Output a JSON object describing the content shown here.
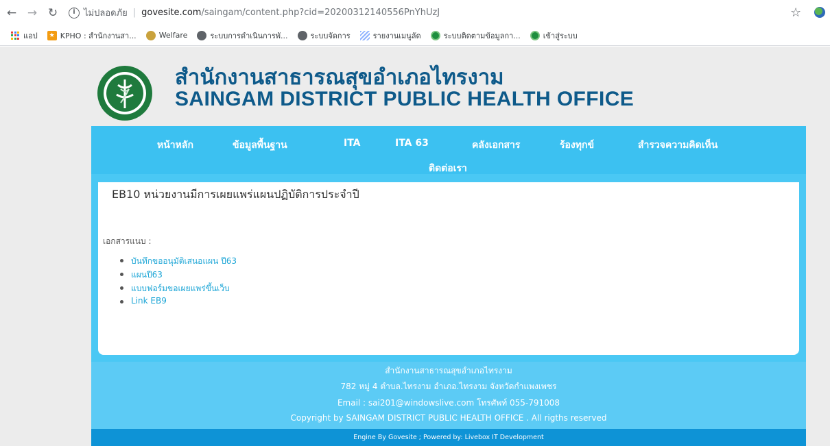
{
  "browser": {
    "security_label": "ไม่ปลอดภัย",
    "url_host": "govesite.com",
    "url_path": "/saingam/content.php?cid=20200312140556PnYhUzJ"
  },
  "bookmarks": [
    {
      "label": "แอป",
      "icon": "apps-grid-icon"
    },
    {
      "label": "KPHO : สำนักงานสา...",
      "icon": "kpho-icon"
    },
    {
      "label": "Welfare",
      "icon": "seal-icon"
    },
    {
      "label": "ระบบการดำเนินการพั...",
      "icon": "globe-icon"
    },
    {
      "label": "ระบบจัดการ",
      "icon": "globe-icon"
    },
    {
      "label": "รายงานเมนูลัด",
      "icon": "report-icon"
    },
    {
      "label": "ระบบติดตามข้อมูลกา...",
      "icon": "green-circle-icon"
    },
    {
      "label": "เข้าสู่ระบบ",
      "icon": "green-circle-icon"
    }
  ],
  "site": {
    "title_th": "สำนักงานสาธารณสุขอำเภอไทรงาม",
    "title_en": "SAINGAM DISTRICT PUBLIC HEALTH OFFICE"
  },
  "nav": {
    "items": [
      "หน้าหลัก",
      "ข้อมูลพื้นฐาน",
      "ITA",
      "ITA 63",
      "คลังเอกสาร",
      "ร้องทุกข์",
      "สำรวจความคิดเห็น",
      "ติดต่อเรา"
    ]
  },
  "content": {
    "title": "EB10 หน่วยงานมีการเผยแพร่แผนปฏิบัติการประจำปี",
    "attachments_label": "เอกสารแนบ :",
    "attachments": [
      "บันทึกขออนุมัติเสนอแผน ปี63",
      "แผนปี63",
      "แบบฟอร์มขอเผยแพร่ขึ้นเว็บ",
      "Link EB9"
    ]
  },
  "footer": {
    "line1": "สำนักงานสาธารณสุขอำเภอไทรงาม",
    "line2": "782 หมู่ 4 ตำบล.ไทรงาม อำเภอ.ไทรงาม จังหวัดกำแพงเพชร",
    "line3": "Email : sai201@windowslive.com  โทรศัพท์ 055-791008",
    "line4": "Copyright by SAINGAM DISTRICT PUBLIC HEALTH OFFICE . All rigths reserved",
    "engine": "Engine By Govesite ; Powered by: Livebox IT Development"
  },
  "colors": {
    "nav_bg": "#3cc1f1",
    "footer_bg": "#5ccbf5",
    "engine_bg": "#0e93d6",
    "title_color": "#0e5a8a",
    "link_color": "#1ba5d6"
  }
}
